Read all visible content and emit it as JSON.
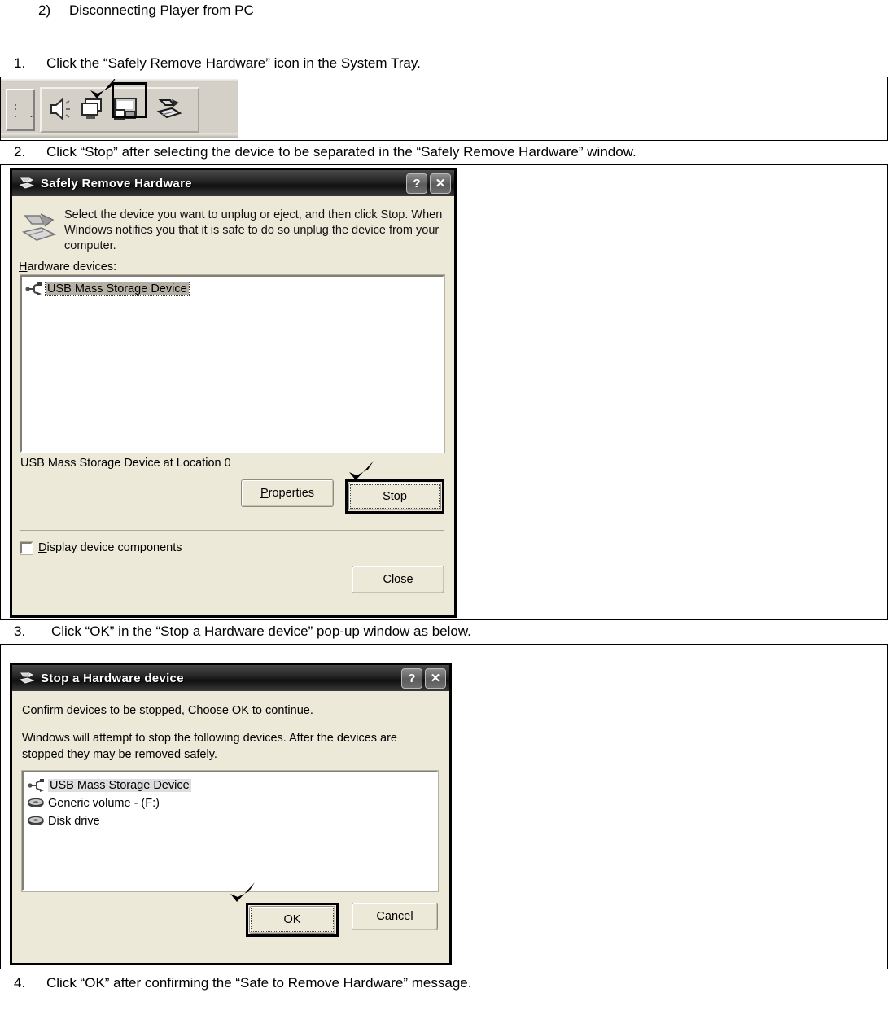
{
  "document": {
    "section_heading": {
      "number": "2)",
      "text": "Disconnecting Player from PC"
    },
    "steps": [
      {
        "number": "1.",
        "text": "Click the “Safely Remove Hardware” icon in the System Tray."
      },
      {
        "number": "2.",
        "text": "Click “Stop” after selecting the device to be separated in the “Safely Remove Hardware” window."
      },
      {
        "number": "3.",
        "text": "Click “OK” in the “Stop a Hardware device” pop-up window as below."
      },
      {
        "number": "4.",
        "text": "Click “OK” after confirming the “Safe to Remove Hardware” message."
      }
    ]
  },
  "system_tray": {
    "icons": [
      {
        "name": "volume-icon",
        "label": "Volume"
      },
      {
        "name": "network-icon",
        "label": "Network Connection"
      },
      {
        "name": "display-icon",
        "label": "Display Properties"
      },
      {
        "name": "safely-remove-hardware-icon",
        "label": "Safely Remove Hardware"
      }
    ],
    "highlighted_icon": "safely-remove-hardware-icon",
    "annotation": "check-mark"
  },
  "safely_remove_dialog": {
    "title": "Safely Remove Hardware",
    "title_buttons": {
      "help": "?",
      "close": "✕"
    },
    "instruction": "Select the device you want to unplug or eject, and then click Stop. When Windows notifies you that it is safe to do so unplug the device from your computer.",
    "hardware_devices_label": "Hardware devices:",
    "hardware_devices_accesskey": "H",
    "devices": [
      {
        "name": "USB Mass Storage Device",
        "icon": "usb-icon",
        "selected": true
      }
    ],
    "status_text": "USB Mass Storage Device at Location 0",
    "buttons": {
      "properties": {
        "label": "Properties",
        "accesskey": "P",
        "focused": false
      },
      "stop": {
        "label": "Stop",
        "accesskey": "S",
        "focused": true
      },
      "close": {
        "label": "Close",
        "accesskey": "C",
        "focused": false
      }
    },
    "checkbox": {
      "label": "Display device components",
      "accesskey": "D",
      "checked": false
    },
    "annotation": "check-mark points at Stop button"
  },
  "stop_hardware_dialog": {
    "title": "Stop a Hardware device",
    "title_buttons": {
      "help": "?",
      "close": "✕"
    },
    "paragraphs": [
      "Confirm devices to be stopped, Choose OK to continue.",
      "Windows will attempt to stop the following devices. After the devices are stopped they may be removed safely."
    ],
    "devices": [
      {
        "name": "USB Mass Storage Device",
        "icon": "usb-icon",
        "selected": true
      },
      {
        "name": "Generic volume - (F:)",
        "icon": "disk-icon",
        "selected": false
      },
      {
        "name": "Disk drive",
        "icon": "disk-icon",
        "selected": false
      }
    ],
    "buttons": {
      "ok": {
        "label": "OK",
        "focused": true
      },
      "cancel": {
        "label": "Cancel",
        "focused": false
      }
    },
    "annotation": "check-mark points at OK button"
  },
  "colors": {
    "dialog_face": "#ece9d8",
    "titlebar_dark": "#1a1a1a",
    "selection": "#b4b0a4",
    "border_black": "#000000",
    "page_background": "#ffffff"
  }
}
